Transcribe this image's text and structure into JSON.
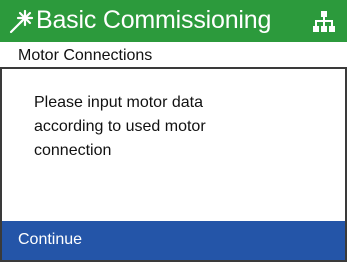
{
  "header": {
    "title": "Basic Commissioning",
    "left_icon": "wizard-wand-icon",
    "right_icon": "device-tree-icon",
    "background_color": "#2c9a3c"
  },
  "subheader": {
    "title": "Motor Connections"
  },
  "message": {
    "lines": [
      "Please input motor data",
      "according to used motor",
      "connection"
    ]
  },
  "actions": {
    "continue_label": "Continue",
    "selected_color": "#2455a8"
  }
}
